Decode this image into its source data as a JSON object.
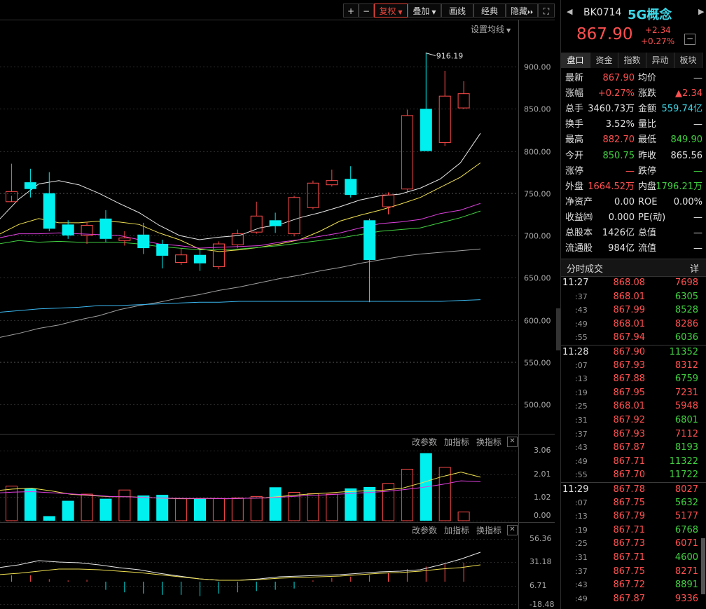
{
  "toolbar": {
    "plus": "+",
    "minus": "−",
    "fuquan": "复权",
    "diejia": "叠加",
    "huaxian": "画线",
    "jingdian": "经典",
    "yincang": "隐藏",
    "expand": "⏵⏵",
    "fullscreen": "⛶"
  },
  "main_settings": "设置均线",
  "indicator_buttons": {
    "params": "改参数",
    "add": "加指标",
    "swap": "换指标",
    "close": "✕"
  },
  "chart_data": {
    "type": "candlestick",
    "high_label": "916.19",
    "price_axis": [
      900,
      850,
      800,
      750,
      700,
      650,
      600,
      550,
      500
    ],
    "price_axis_labels": [
      "900.00",
      "850.00",
      "800.00",
      "750.00",
      "700.00",
      "650.00",
      "600.00",
      "550.00",
      "500.00"
    ],
    "candles": [
      {
        "o": 740,
        "c": 752,
        "h": 785,
        "l": 747
      },
      {
        "o": 763,
        "c": 755,
        "h": 779,
        "l": 745
      },
      {
        "o": 750,
        "c": 708,
        "h": 775,
        "l": 705
      },
      {
        "o": 713,
        "c": 700,
        "h": 718,
        "l": 696
      },
      {
        "o": 700,
        "c": 712,
        "h": 716,
        "l": 690
      },
      {
        "o": 720,
        "c": 696,
        "h": 730,
        "l": 692
      },
      {
        "o": 694,
        "c": 697,
        "h": 705,
        "l": 688
      },
      {
        "o": 701,
        "c": 685,
        "h": 715,
        "l": 678
      },
      {
        "o": 690,
        "c": 676,
        "h": 695,
        "l": 661
      },
      {
        "o": 668,
        "c": 677,
        "h": 685,
        "l": 665
      },
      {
        "o": 677,
        "c": 667,
        "h": 683,
        "l": 658
      },
      {
        "o": 663,
        "c": 690,
        "h": 693,
        "l": 660
      },
      {
        "o": 689,
        "c": 702,
        "h": 707,
        "l": 685
      },
      {
        "o": 704,
        "c": 723,
        "h": 740,
        "l": 702
      },
      {
        "o": 718,
        "c": 711,
        "h": 727,
        "l": 703
      },
      {
        "o": 702,
        "c": 745,
        "h": 747,
        "l": 699
      },
      {
        "o": 733,
        "c": 762,
        "h": 765,
        "l": 731
      },
      {
        "o": 760,
        "c": 765,
        "h": 778,
        "l": 758
      },
      {
        "o": 767,
        "c": 748,
        "h": 782,
        "l": 745
      },
      {
        "o": 718,
        "c": 671,
        "h": 720,
        "l": 621
      },
      {
        "o": 734,
        "c": 748,
        "h": 751,
        "l": 725
      },
      {
        "o": 755,
        "c": 842,
        "h": 849,
        "l": 752
      },
      {
        "o": 850,
        "c": 800,
        "h": 916.19,
        "l": 800
      },
      {
        "o": 810,
        "c": 865,
        "h": 895,
        "l": 806
      },
      {
        "o": 851,
        "c": 867.9,
        "h": 882.7,
        "l": 849.9
      }
    ],
    "ma_lines": [
      {
        "color": "#e8e8e8",
        "values": [
          718,
          743,
          761,
          765,
          760,
          750,
          738,
          727,
          712,
          700,
          695,
          698,
          700,
          709,
          713,
          721,
          727,
          734,
          742,
          747,
          749,
          756,
          767,
          786,
          821
        ]
      },
      {
        "color": "#f0e050",
        "values": [
          701,
          713,
          720,
          715,
          715,
          717,
          716,
          713,
          703,
          695,
          684,
          681,
          683,
          686,
          690,
          695,
          705,
          717,
          724,
          730,
          737,
          745,
          757,
          769,
          786
        ]
      },
      {
        "color": "#e040e0",
        "values": [
          697,
          702,
          702,
          703,
          702,
          701,
          700,
          695,
          690,
          688,
          685,
          686,
          687,
          688,
          692,
          695,
          699,
          703,
          709,
          714,
          716,
          719,
          726,
          730,
          738
        ]
      },
      {
        "color": "#40d040",
        "values": [
          690,
          694,
          692,
          693,
          692,
          692,
          692,
          690,
          687,
          685,
          683,
          683,
          684,
          686,
          688,
          691,
          694,
          697,
          701,
          705,
          707,
          709,
          715,
          721,
          729
        ]
      },
      {
        "color": "#a0a0a0",
        "values": [
          579,
          584,
          590,
          594,
          600,
          605,
          612,
          617,
          621,
          626,
          630,
          635,
          639,
          644,
          649,
          653,
          658,
          662,
          667,
          671,
          675,
          678,
          680,
          682,
          684
        ]
      },
      {
        "color": "#3ab8f0",
        "values": [
          609,
          611,
          613,
          614,
          615,
          617,
          617,
          618,
          619,
          620,
          621,
          621,
          622,
          622,
          622,
          622,
          622,
          622,
          622,
          622,
          622,
          622,
          622,
          623,
          624
        ]
      }
    ],
    "vol_axis": [
      "3.06",
      "2.01",
      "1.02",
      "0.00"
    ],
    "volumes": [
      1.51,
      1.51,
      1.41,
      0.2,
      0.87,
      1.16,
      0.96,
      1.34,
      1.1,
      1.13,
      0.96,
      0.96,
      0.97,
      0.99,
      1.06,
      1.46,
      1.24,
      1.18,
      1.16,
      1.41,
      1.47,
      1.63,
      2.25,
      2.95,
      2.33,
      0.38
    ],
    "vol_ma": [
      {
        "color": "#f0e050",
        "values": [
          1.3,
          1.38,
          1.42,
          1.3,
          1.15,
          1.1,
          1.05,
          1.05,
          1.0,
          0.97,
          0.96,
          0.97,
          0.96,
          0.98,
          1.0,
          1.08,
          1.15,
          1.2,
          1.26,
          1.3,
          1.33,
          1.42,
          1.66,
          1.92,
          2.12,
          1.9
        ]
      },
      {
        "color": "#e040e0",
        "values": [
          1.2,
          1.25,
          1.27,
          1.22,
          1.17,
          1.12,
          1.06,
          1.04,
          1.0,
          0.98,
          0.97,
          0.97,
          0.96,
          0.98,
          0.99,
          1.04,
          1.09,
          1.13,
          1.17,
          1.22,
          1.27,
          1.35,
          1.45,
          1.58,
          1.74,
          1.7
        ]
      }
    ],
    "osc_axis": [
      "56.36",
      "31.18",
      "6.71",
      "-18.48"
    ]
  },
  "quote": {
    "code": "BK0714",
    "name": "5G概念",
    "price": "867.90",
    "change": "+2.34",
    "pct": "+0.27%",
    "toggle": "−"
  },
  "tabs": [
    "盘口",
    "资金",
    "指数",
    "异动",
    "板块"
  ],
  "fields": [
    {
      "l1": "最新",
      "v1": "867.90",
      "c1": "red",
      "l2": "均价",
      "v2": "—",
      "c2": "white"
    },
    {
      "l1": "涨幅",
      "v1": "+0.27%",
      "c1": "red",
      "l2": "涨跌",
      "v2": "▲2.34",
      "c2": "red"
    },
    {
      "l1": "总手",
      "v1": "3460.73万",
      "c1": "white",
      "l2": "金额",
      "v2": "559.74亿",
      "c2": "cyan"
    },
    {
      "l1": "换手",
      "v1": "3.52%",
      "c1": "white",
      "l2": "量比",
      "v2": "—",
      "c2": "white"
    },
    {
      "l1": "最高",
      "v1": "882.70",
      "c1": "red",
      "l2": "最低",
      "v2": "849.90",
      "c2": "green"
    },
    {
      "l1": "今开",
      "v1": "850.75",
      "c1": "green",
      "l2": "昨收",
      "v2": "865.56",
      "c2": "white"
    },
    {
      "l1": "涨停",
      "v1": "—",
      "c1": "red",
      "l2": "跌停",
      "v2": "—",
      "c2": "green"
    },
    {
      "l1": "外盘",
      "v1": "1664.52万",
      "c1": "red",
      "l2": "内盘",
      "v2": "1796.21万",
      "c2": "green"
    },
    {
      "l1": "净资产",
      "v1": "0.00",
      "c1": "white",
      "l2": "ROE",
      "v2": "0.00%",
      "c2": "white"
    },
    {
      "l1": "收益㈣",
      "v1": "0.000",
      "c1": "white",
      "l2": "PE(动)",
      "v2": "—",
      "c2": "white"
    },
    {
      "l1": "总股本",
      "v1": "1426亿",
      "c1": "white",
      "l2": "总值",
      "v2": "—",
      "c2": "white"
    },
    {
      "l1": "流通股",
      "v1": "984亿",
      "c1": "white",
      "l2": "流值",
      "v2": "—",
      "c2": "white"
    }
  ],
  "ticks_header": {
    "title": "分时成交",
    "detail": "详"
  },
  "ticks": [
    {
      "t": "11:27",
      "p": "868.08",
      "v": "7698",
      "vc": "red"
    },
    {
      "t": ":37",
      "p": "868.01",
      "v": "6305",
      "vc": "green"
    },
    {
      "t": ":43",
      "p": "867.99",
      "v": "8528",
      "vc": "green"
    },
    {
      "t": ":49",
      "p": "868.01",
      "v": "8286",
      "vc": "red"
    },
    {
      "t": ":55",
      "p": "867.94",
      "v": "6036",
      "vc": "green"
    },
    {
      "t": "11:28",
      "p": "867.90",
      "v": "11352",
      "vc": "green"
    },
    {
      "t": ":07",
      "p": "867.93",
      "v": "8312",
      "vc": "red"
    },
    {
      "t": ":13",
      "p": "867.88",
      "v": "6759",
      "vc": "green"
    },
    {
      "t": ":19",
      "p": "867.95",
      "v": "7231",
      "vc": "red"
    },
    {
      "t": ":25",
      "p": "868.01",
      "v": "5948",
      "vc": "red"
    },
    {
      "t": ":31",
      "p": "867.92",
      "v": "6801",
      "vc": "green"
    },
    {
      "t": ":37",
      "p": "867.93",
      "v": "7112",
      "vc": "red"
    },
    {
      "t": ":43",
      "p": "867.87",
      "v": "8193",
      "vc": "green"
    },
    {
      "t": ":49",
      "p": "867.71",
      "v": "11322",
      "vc": "green"
    },
    {
      "t": ":55",
      "p": "867.70",
      "v": "11722",
      "vc": "green"
    },
    {
      "t": "11:29",
      "p": "867.78",
      "v": "8027",
      "vc": "red"
    },
    {
      "t": ":07",
      "p": "867.75",
      "v": "5632",
      "vc": "green"
    },
    {
      "t": ":13",
      "p": "867.79",
      "v": "5177",
      "vc": "red"
    },
    {
      "t": ":19",
      "p": "867.71",
      "v": "6768",
      "vc": "green"
    },
    {
      "t": ":25",
      "p": "867.73",
      "v": "6071",
      "vc": "red"
    },
    {
      "t": ":31",
      "p": "867.71",
      "v": "4600",
      "vc": "green"
    },
    {
      "t": ":37",
      "p": "867.75",
      "v": "8271",
      "vc": "red"
    },
    {
      "t": ":43",
      "p": "867.72",
      "v": "8891",
      "vc": "green"
    },
    {
      "t": ":49",
      "p": "867.87",
      "v": "9336",
      "vc": "red"
    }
  ]
}
